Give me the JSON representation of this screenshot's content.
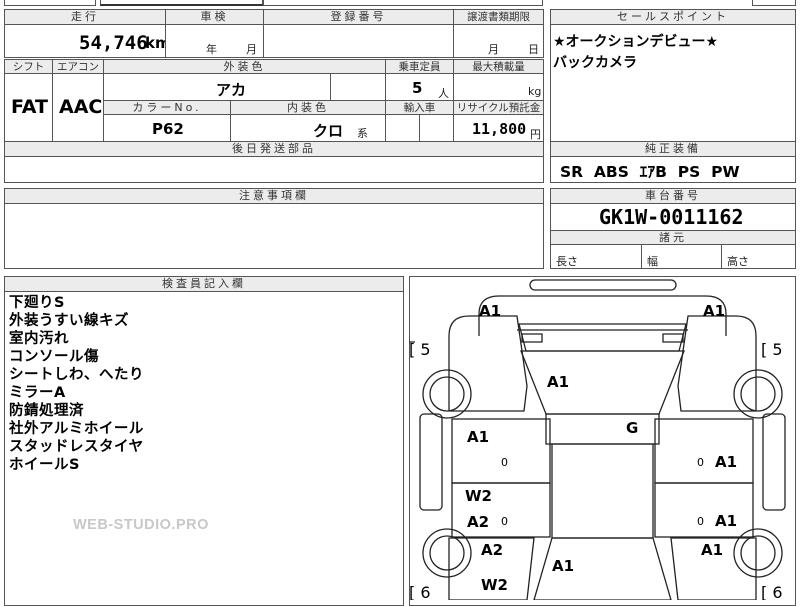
{
  "mileage": {
    "header": "走行",
    "value": "54,746",
    "unit": "km"
  },
  "inspection": {
    "header": "車検",
    "year_unit": "年",
    "month_unit": "月"
  },
  "registration": {
    "header": "登録番号"
  },
  "transfer_deadline": {
    "header": "譲渡書類期限",
    "month_unit": "月",
    "day_unit": "日"
  },
  "sales_point": {
    "header": "セールスポイント",
    "lines": [
      "★オークションデビュー★",
      "バックカメラ"
    ]
  },
  "shift": {
    "header": "シフト",
    "value": "FAT"
  },
  "aircon": {
    "header": "エアコン",
    "value": "AAC"
  },
  "exterior_color": {
    "header": "外装色",
    "value": "アカ"
  },
  "capacity": {
    "header": "乗車定員",
    "value": "5",
    "unit": "人"
  },
  "max_load": {
    "header": "最大積載量",
    "unit": "kg"
  },
  "color_no": {
    "header": "カラーNo.",
    "value": "P62"
  },
  "interior_color": {
    "header": "内装色",
    "value": "クロ",
    "suffix": "系"
  },
  "import": {
    "header": "輸入車"
  },
  "recycle": {
    "header": "リサイクル預託金",
    "value": "11,800",
    "unit": "円"
  },
  "shipping_parts": {
    "header": "後日発送部品"
  },
  "genuine_equipment": {
    "header": "純正装備",
    "value": "SR  ABS  ｴｱB  PS  PW"
  },
  "cautions": {
    "header": "注意事項欄"
  },
  "chassis": {
    "header": "車台番号",
    "value": "GK1W-0011162"
  },
  "dimensions": {
    "header": "諸元",
    "length_label": "長さ",
    "width_label": "幅",
    "height_label": "高さ"
  },
  "inspector_notes": {
    "header": "検査員記入欄",
    "lines": [
      "下廻りS",
      "外装うすい線キズ",
      "室内汚れ",
      "コンソール傷",
      "シートしわ、へたり",
      "ミラーA",
      "防錆処理済",
      "社外アルミホイール",
      "スタッドレスタイヤ",
      "ホイールS"
    ]
  },
  "watermark": "WEB-STUDIO.PRO",
  "diagram": {
    "front_left": "A1",
    "front_right": "A1",
    "bracket_left_top": "[ 5",
    "bracket_right_top": "[ 5",
    "bracket_left_bottom": "[ 6",
    "bracket_right_bottom": "[ 6",
    "windshield": "A1",
    "roof": "G",
    "front_door_left": "A1",
    "front_door_right": "A1",
    "rear_door_left_1": "W2",
    "rear_door_left_2": "A2",
    "rear_door_right": "A1",
    "rear_fender_left": "A2",
    "rear_fender_right": "A1",
    "rear_quarter_left": "W2",
    "rear_glass": "A1",
    "small_mark": "0"
  }
}
